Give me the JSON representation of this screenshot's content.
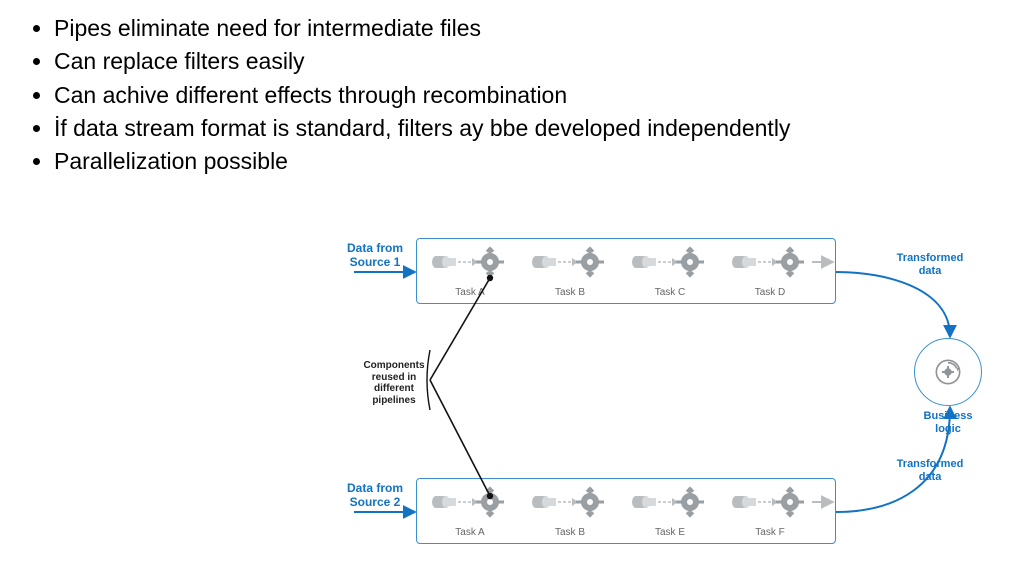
{
  "bullets": {
    "b0": "Pipes eliminate need for intermediate files",
    "b1": "Can replace filters easily",
    "b2": "Can achive different effects through recombination",
    "b3": "İf data stream format is standard, filters ay bbe developed independently",
    "b4": "Parallelization possible"
  },
  "diagram": {
    "source1": "Data from\nSource 1",
    "source2": "Data from\nSource 2",
    "transformed": "Transformed\ndata",
    "reuse": "Components\nreused in\ndifferent\npipelines",
    "business": "Business\nlogic",
    "pipeline1": {
      "t0": "Task A",
      "t1": "Task B",
      "t2": "Task C",
      "t3": "Task D"
    },
    "pipeline2": {
      "t0": "Task A",
      "t1": "Task B",
      "t2": "Task E",
      "t3": "Task F"
    }
  },
  "colors": {
    "blue": "#1272c4",
    "box": "#3b8fcf",
    "arrow": "#1272c4",
    "gray": "#9a9fa3",
    "pipeGray": "#b9bdc0"
  }
}
